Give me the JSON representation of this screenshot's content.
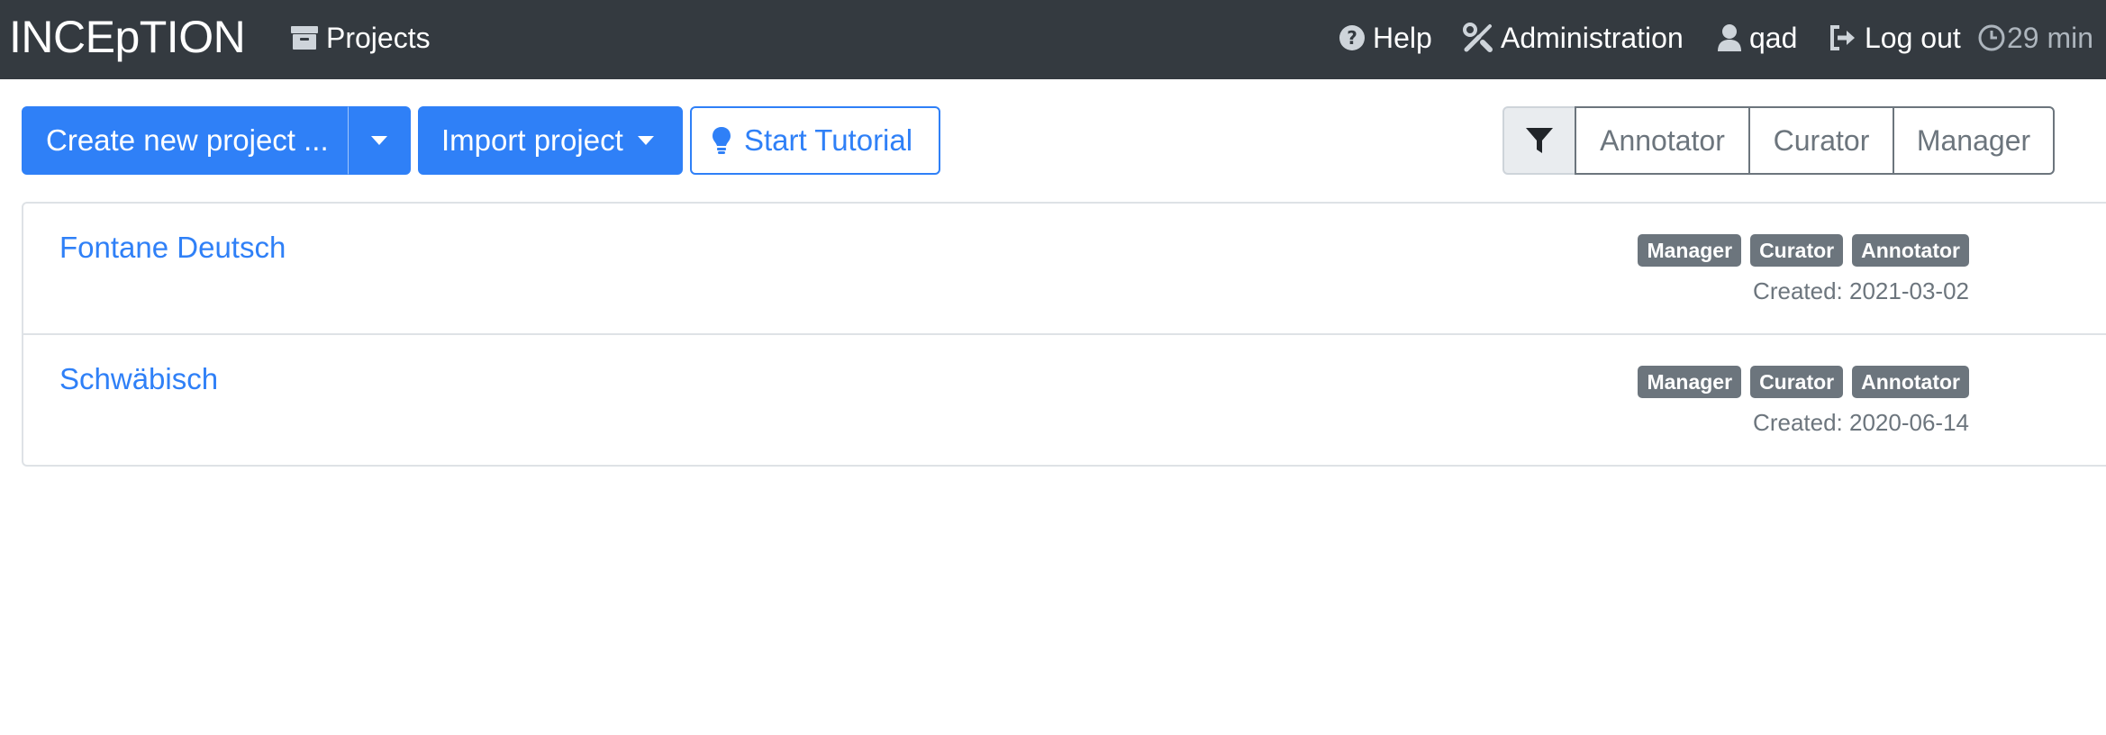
{
  "navbar": {
    "brand": "INCEpTION",
    "projects_label": "Projects",
    "help_label": "Help",
    "administration_label": "Administration",
    "user_label": "qad",
    "logout_label": "Log out",
    "session_timer": "29 min",
    "icons": {
      "projects": "archive-box-icon",
      "help": "question-circle-icon",
      "administration": "tools-icon",
      "user": "user-icon",
      "logout": "sign-out-icon",
      "timer": "clock-icon"
    }
  },
  "toolbar": {
    "create_project_label": "Create new project ...",
    "import_project_label": "Import project",
    "start_tutorial_label": "Start Tutorial",
    "tutorial_icon": "lightbulb-icon",
    "primary_color": "#2f80f7"
  },
  "role_filter": {
    "filter_icon": "filter-funnel-icon",
    "options": [
      "Annotator",
      "Curator",
      "Manager"
    ]
  },
  "projects": [
    {
      "name": "Fontane Deutsch",
      "roles": [
        "Manager",
        "Curator",
        "Annotator"
      ],
      "created": "Created: 2021-03-02"
    },
    {
      "name": "Schwäbisch",
      "roles": [
        "Manager",
        "Curator",
        "Annotator"
      ],
      "created": "Created: 2020-06-14"
    }
  ]
}
